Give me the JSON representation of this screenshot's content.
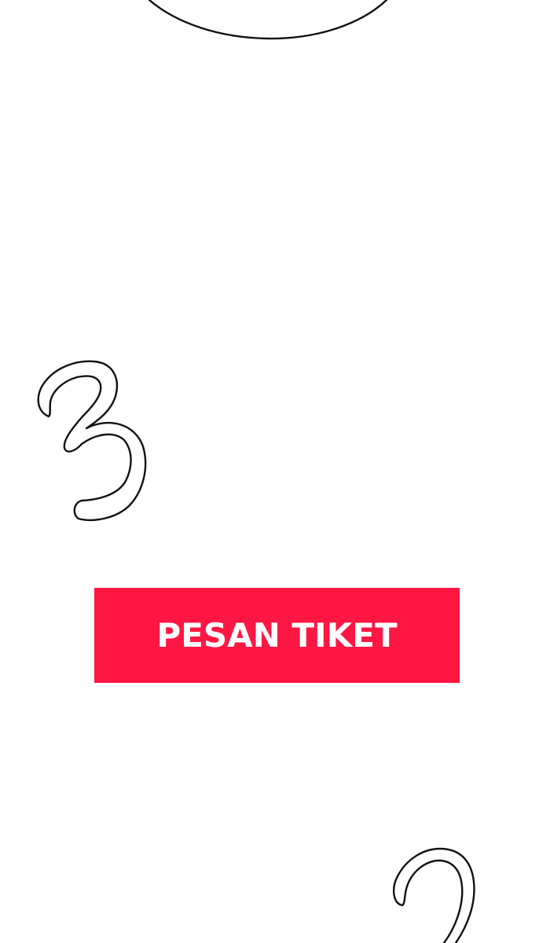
{
  "colors": {
    "background": "#ffffff",
    "accent": "#ff1744",
    "stroke": "#111111"
  },
  "doodles": {
    "top": "curve-doodle",
    "left": "digit-three-doodle",
    "bottom_right": "hook-doodle"
  },
  "cta": {
    "label": "PESAN TIKET"
  }
}
